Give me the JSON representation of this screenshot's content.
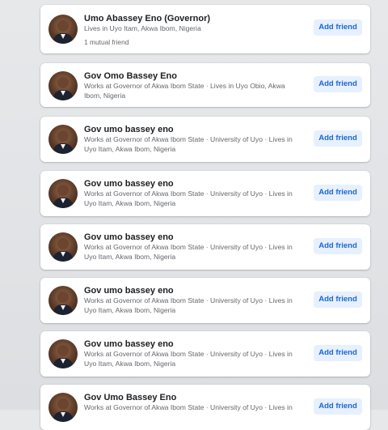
{
  "results": [
    {
      "name": "Umo Abassey Eno (Governor)",
      "description": "Lives in Uyo Itam, Akwa Ibom, Nigeria",
      "mutual": "1 mutual friend",
      "action_label": "Add friend",
      "avatar_icon": "profile-photo"
    },
    {
      "name": "Gov Omo Bassey Eno",
      "description": "Works at Governor of Akwa Ibom State · Lives in Uyo Obio, Akwa Ibom, Nigeria",
      "action_label": "Add friend",
      "avatar_icon": "profile-photo"
    },
    {
      "name": "Gov umo bassey eno",
      "description": "Works at Governor of Akwa Ibom State · University of Uyo · Lives in Uyo Itam, Akwa Ibom, Nigeria",
      "action_label": "Add friend",
      "avatar_icon": "profile-photo"
    },
    {
      "name": "Gov umo bassey eno",
      "description": "Works at Governor of Akwa Ibom State · University of Uyo · Lives in Uyo Itam, Akwa Ibom, Nigeria",
      "action_label": "Add friend",
      "avatar_icon": "profile-photo"
    },
    {
      "name": "Gov umo bassey eno",
      "description": "Works at Governor of Akwa Ibom State · University of Uyo · Lives in Uyo Itam, Akwa Ibom, Nigeria",
      "action_label": "Add friend",
      "avatar_icon": "profile-photo"
    },
    {
      "name": "Gov umo bassey eno",
      "description": "Works at Governor of Akwa Ibom State · University of Uyo · Lives in Uyo Itam, Akwa Ibom, Nigeria",
      "action_label": "Add friend",
      "avatar_icon": "profile-photo"
    },
    {
      "name": "Gov umo bassey eno",
      "description": "Works at Governor of Akwa Ibom State · University of Uyo · Lives in Uyo Itam, Akwa Ibom, Nigeria",
      "action_label": "Add friend",
      "avatar_icon": "profile-photo"
    },
    {
      "name": "Gov Umo Bassey Eno",
      "description": "Works at Governor of Akwa Ibom State · University of Uyo · Lives in",
      "action_label": "Add friend",
      "avatar_icon": "profile-photo"
    }
  ],
  "colors": {
    "accent": "#1b66d2",
    "button_bg": "#e7f0fd",
    "secondary_text": "#65676b"
  }
}
